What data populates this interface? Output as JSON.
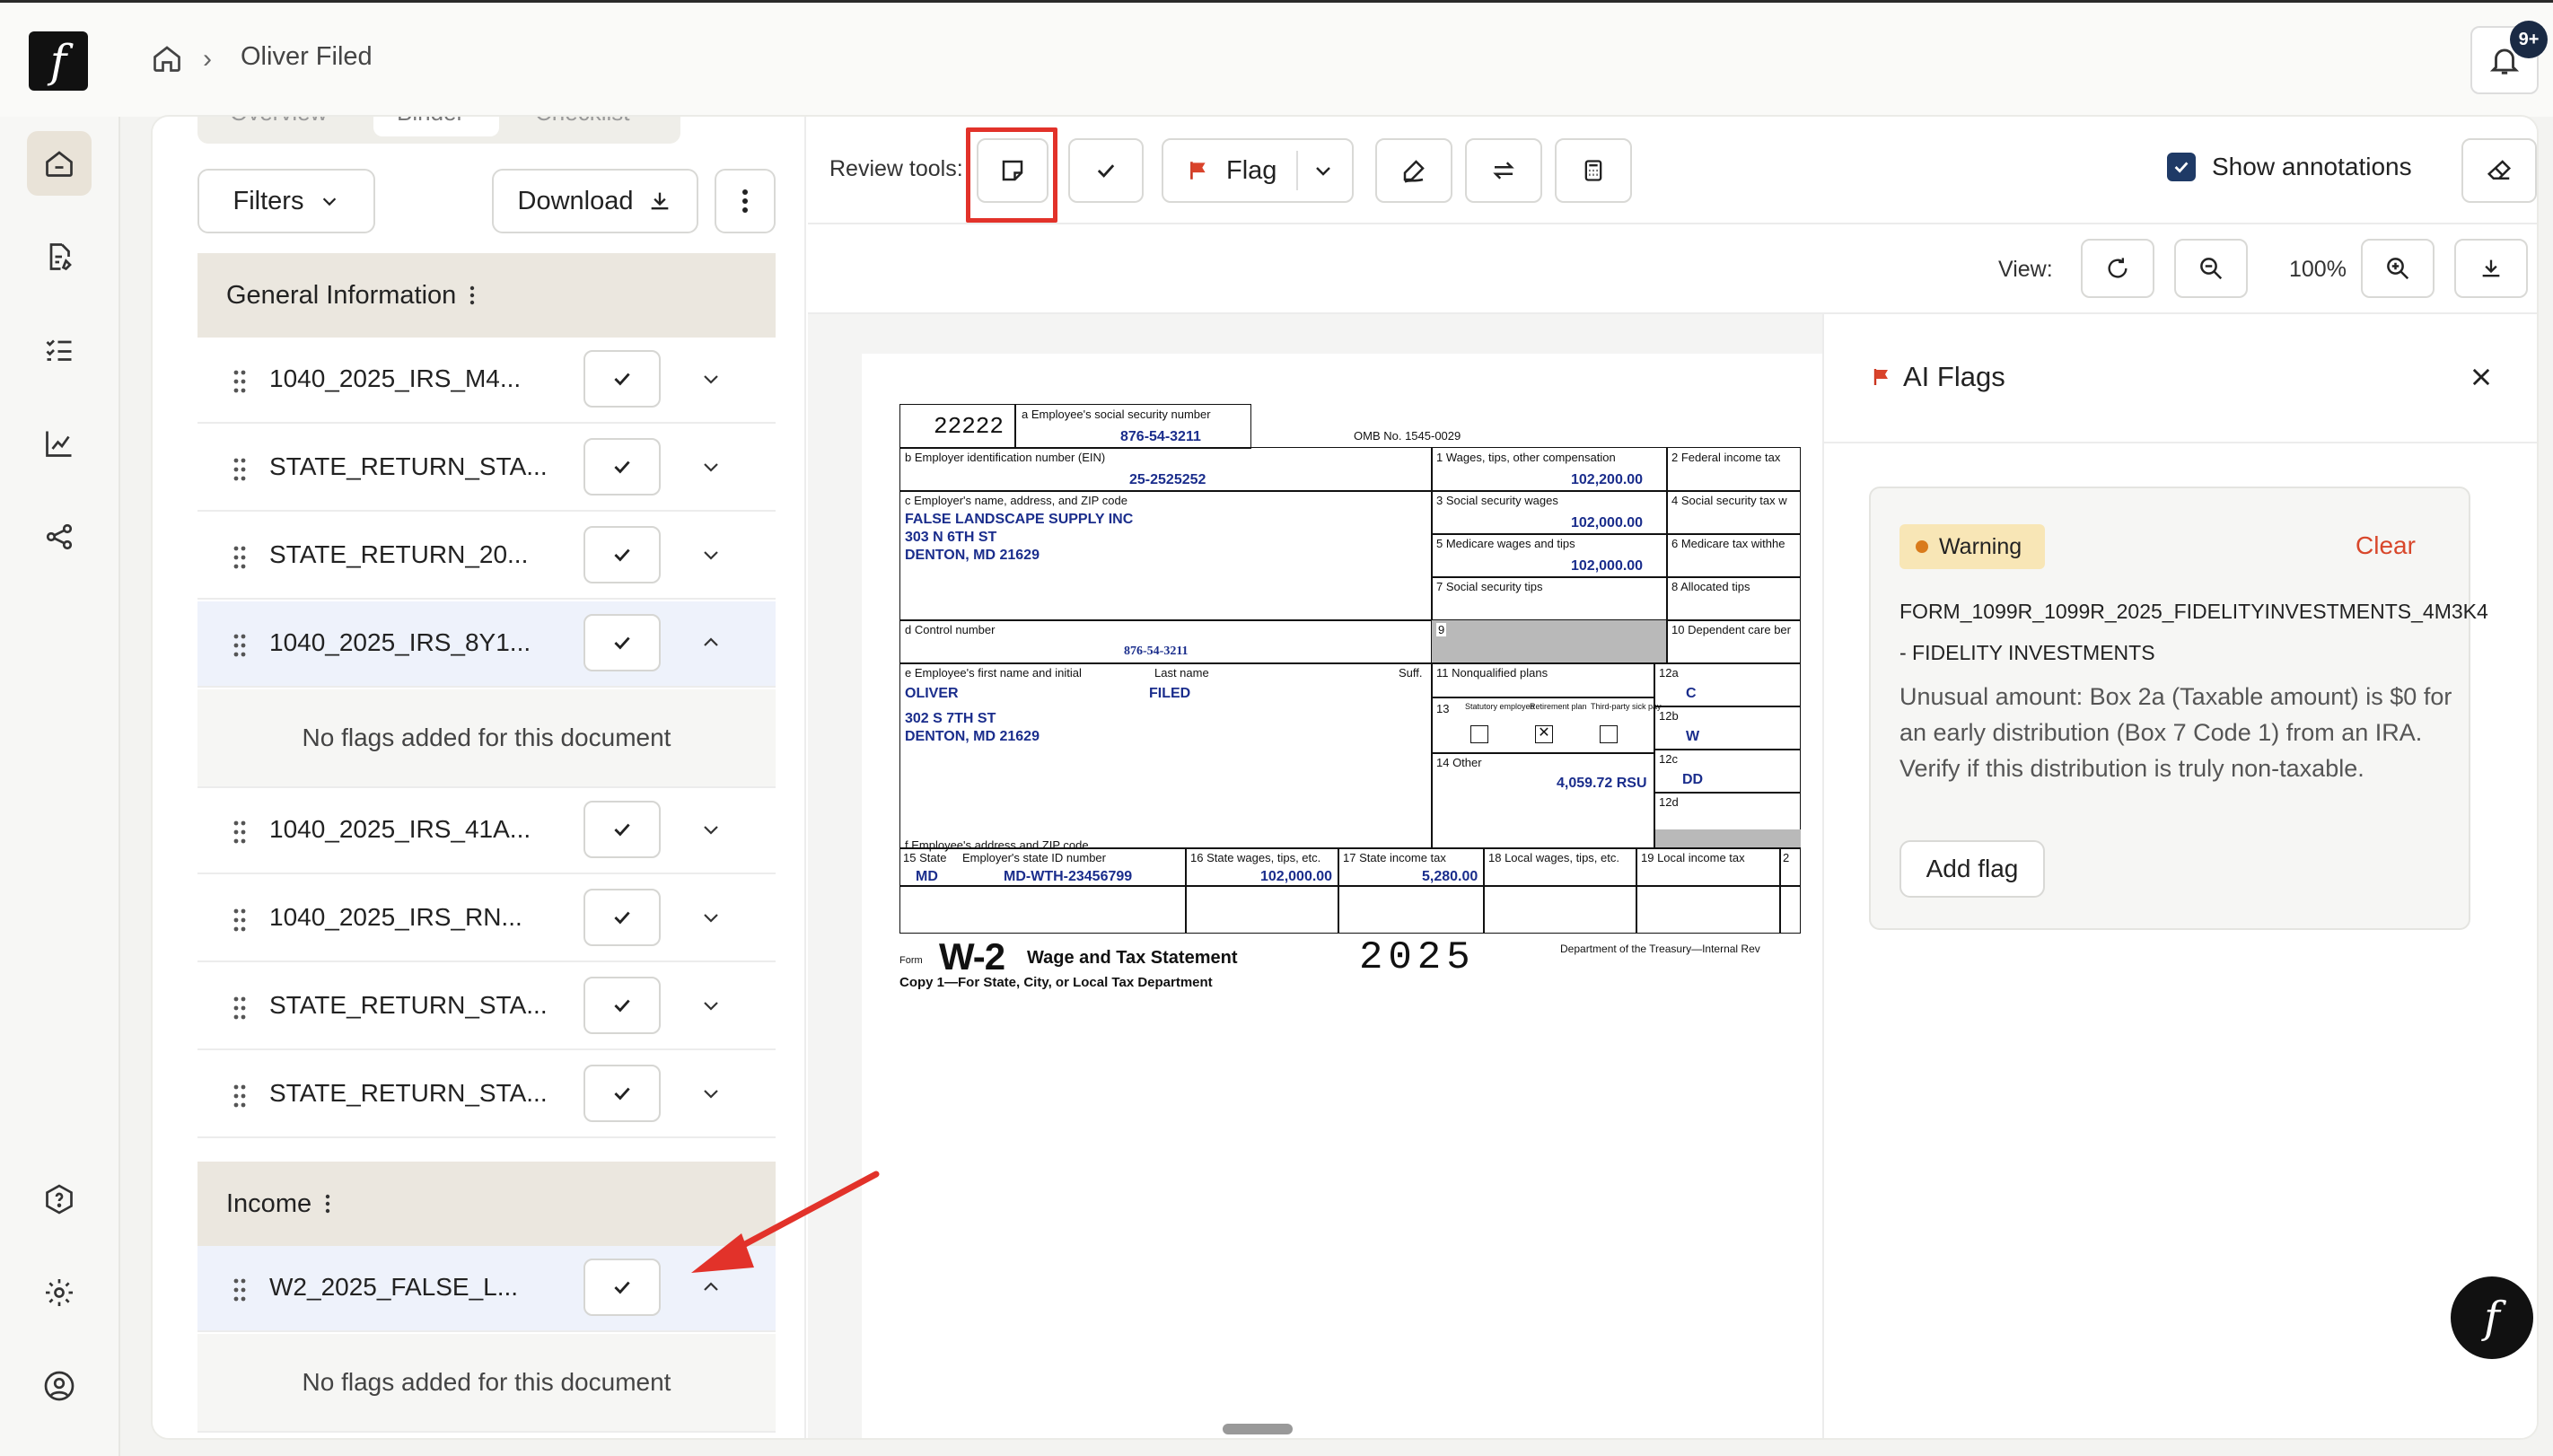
{
  "app": {
    "breadcrumb_title": "Oliver Filed",
    "notification_badge": "9+",
    "logo_glyph": "f"
  },
  "rail": {
    "items": [
      "home-icon",
      "document-edit-icon",
      "checklist-icon",
      "chart-icon",
      "share-icon",
      "help-icon",
      "gear-icon",
      "user-circle-icon"
    ]
  },
  "left": {
    "tabs": [
      "Overview",
      "Binder",
      "Checklist"
    ],
    "filters_label": "Filters",
    "download_label": "Download",
    "sections": [
      {
        "title": "General Information"
      },
      {
        "title": "Income"
      }
    ],
    "rows": [
      {
        "name": "1040_2025_IRS_M4..."
      },
      {
        "name": "STATE_RETURN_STA..."
      },
      {
        "name": "STATE_RETURN_20..."
      },
      {
        "name": "1040_2025_IRS_8Y1..."
      },
      {
        "name": "1040_2025_IRS_41A..."
      },
      {
        "name": "1040_2025_IRS_RN..."
      },
      {
        "name": "STATE_RETURN_STA..."
      },
      {
        "name": "STATE_RETURN_STA..."
      },
      {
        "name": "W2_2025_FALSE_L..."
      }
    ],
    "no_flags_text": "No flags added for this document"
  },
  "toolbar": {
    "review_tools_label": "Review tools:",
    "flag_label": "Flag",
    "show_annotations_label": "Show annotations",
    "show_annotations_checked": true
  },
  "viewbar": {
    "view_label": "View:",
    "zoom": "100%"
  },
  "w2": {
    "control_code": "22222",
    "ssn_label": "a Employee's social security number",
    "ssn": "876-54-3211",
    "omb": "OMB No. 1545-0029",
    "ein_label": "b Employer identification number (EIN)",
    "ein": "25-2525252",
    "employer_label": "c Employer's name, address, and ZIP code",
    "employer_name": "FALSE LANDSCAPE SUPPLY INC",
    "employer_street": "303 N 6TH ST",
    "employer_city": "DENTON, MD 21629",
    "control_label": "d Control number",
    "control_number": "876-54-3211",
    "emp_first_label": "e Employee's first name and initial",
    "emp_last_label": "Last name",
    "suff_label": "Suff.",
    "emp_first": "OLIVER",
    "emp_last": "FILED",
    "emp_street": "302 S 7TH ST",
    "emp_city": "DENTON, MD 21629",
    "emp_addr_label": "f Employee's address and ZIP code",
    "b1_label": "1 Wages, tips, other compensation",
    "b1": "102,200.00",
    "b2_label": "2 Federal income tax",
    "b3_label": "3 Social security wages",
    "b3": "102,000.00",
    "b4_label": "4 Social security tax w",
    "b5_label": "5 Medicare wages and tips",
    "b5": "102,000.00",
    "b6_label": "6 Medicare tax withhe",
    "b7_label": "7 Social security tips",
    "b8_label": "8 Allocated tips",
    "b9_label": "9",
    "b10_label": "10 Dependent care ber",
    "b11_label": "11 Nonqualified plans",
    "b12a_label": "12a",
    "b12a_code": "C",
    "b12b_label": "12b",
    "b12b_code": "W",
    "b12c_label": "12c",
    "b12c_code": "DD",
    "b12d_label": "12d",
    "b13_label": "13",
    "b13_statutory": "Statutory employee",
    "b13_retirement": "Retirement plan",
    "b13_thirdparty": "Third-party sick pay",
    "b14_label": "14 Other",
    "b14": "4,059.72 RSU",
    "b15_label": "15 State",
    "b15_id_label": "Employer's state ID number",
    "b15_state": "MD",
    "b15_id": "MD-WTH-23456799",
    "b16_label": "16 State wages, tips, etc.",
    "b16": "102,000.00",
    "b17_label": "17 State income tax",
    "b17": "5,280.00",
    "b18_label": "18 Local wages, tips, etc.",
    "b19_label": "19 Local income tax",
    "b20_label": "2",
    "form_word": "Form",
    "form_name": "W-2",
    "form_title": "Wage and Tax Statement",
    "year": "2025",
    "dept": "Department of the Treasury—Internal Rev",
    "copy": "Copy 1—For State, City, or Local Tax Department"
  },
  "flags": {
    "title": "AI Flags",
    "badge": "Warning",
    "clear_label": "Clear",
    "doc_title": "FORM_1099R_1099R_2025_FIDELITYINVESTMENTS_4M3K4",
    "doc_sub": "- FIDELITY INVESTMENTS",
    "description": "Unusual amount: Box 2a (Taxable amount) is $0 for an early distribution (Box 7 Code 1) from an IRA. Verify if this distribution is truly non-taxable.",
    "add_flag_label": "Add flag"
  },
  "colors": {
    "accent_red": "#e2322a",
    "navy": "#1f3a66",
    "section_bg": "#ebe7df",
    "selected_row": "#eef2fb"
  }
}
